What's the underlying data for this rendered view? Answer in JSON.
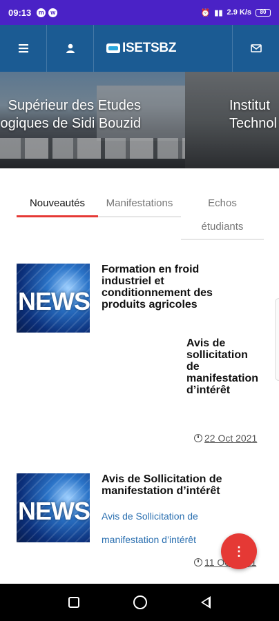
{
  "status_bar": {
    "time": "09:13",
    "network_speed": "2.9 K/s",
    "battery": "80"
  },
  "app_bar": {
    "logo_text": "ISETSBZ"
  },
  "hero": {
    "slide_1_line_1": "Supérieur des Etudes",
    "slide_1_line_2": "ogiques de Sidi Bouzid",
    "slide_2_line_1": "Institut",
    "slide_2_line_2": "Technol"
  },
  "tabs": [
    {
      "label": "Nouveautés"
    },
    {
      "label": "Manifestations"
    },
    {
      "label_line_1": "Echos",
      "label_line_2": "étudiants"
    }
  ],
  "news": [
    {
      "thumb_text": "NEWS",
      "title_line_1": "Formation en froid",
      "title_line_2": "industriel et",
      "title_line_3": "conditionnement des",
      "title_line_4": "produits agricoles",
      "sub_line_1": "Avis de",
      "sub_line_2": "sollicitation",
      "sub_line_3": "de",
      "sub_line_4": "manifestation",
      "sub_line_5": "d’intérêt",
      "date": "22 Oct 2021"
    },
    {
      "thumb_text": "NEWS",
      "title_line_1": "Avis de Sollicitation de",
      "title_line_2": "manifestation d’intérêt",
      "link_line_1": "Avis de Sollicitation de",
      "link_line_2": "manifestation d’intérêt",
      "date": "11 Oct 2021"
    }
  ],
  "fab": {
    "label": "⋮"
  },
  "colors": {
    "status_bar": "#4a22c6",
    "app_bar": "#1b5b93",
    "accent": "#e53935",
    "link": "#2a6fb0"
  }
}
